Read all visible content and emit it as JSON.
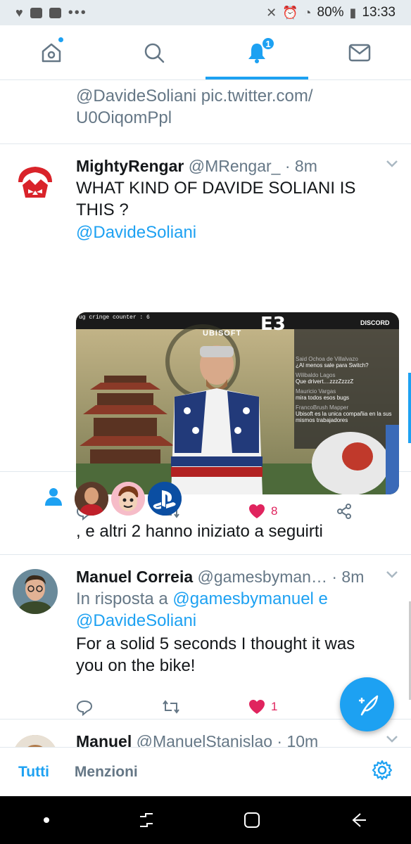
{
  "status": {
    "battery": "80%",
    "time": "13:33"
  },
  "nav": {
    "notifications_badge": "1"
  },
  "feed": {
    "partial": {
      "text_mention": "@DavideSoliani",
      "text_link": " pic.twitter.com/ U0OiqomPpl"
    },
    "tweet1": {
      "name": "MightyRengar",
      "handle": "@MRengar_",
      "time": "· 8m",
      "text": "WHAT KIND OF DAVIDE SOLIANI IS THIS ?",
      "mention": "@DavideSoliani",
      "likes": "8",
      "media": {
        "overlay_top": "ug cringe counter : 6",
        "brand1": "UBISOFT",
        "brand2": "E3",
        "brand3": "DISCORD",
        "chat": [
          {
            "user": "Said Ochoa de Villalvazo",
            "msg": "¿Al menos sale para Switch?"
          },
          {
            "user": "Wilibaldo Lagos",
            "msg": "Que drivert....zzzZzzzZ"
          },
          {
            "user": "Mauricio Vargas",
            "msg": "mira todos esos bugs"
          },
          {
            "user": "FrancoBrush Mapper",
            "msg": "Ubisoft es la unica compañia en la sus mismos trabajadores"
          }
        ]
      }
    },
    "follow": {
      "text": ", e altri 2 hanno iniziato a seguirti"
    },
    "tweet2": {
      "name": "Manuel Correia",
      "handle": "@gamesbyman…",
      "time": "· 8m",
      "reply_prefix": "In risposta a",
      "reply_to1": "@gamesbymanuel",
      "reply_and": "e",
      "reply_to2": "@DavideSoliani",
      "text": "For a solid 5 seconds I thought it was you on the bike!",
      "likes": "1"
    },
    "tweet3": {
      "name": "Manuel",
      "handle": "@ManuelStanislao",
      "time": "· 10m"
    }
  },
  "bottom_tabs": {
    "all": "Tutti",
    "mentions": "Menzioni"
  },
  "colors": {
    "accent": "#1da1f2",
    "like": "#e0245e",
    "secondary": "#657786"
  }
}
